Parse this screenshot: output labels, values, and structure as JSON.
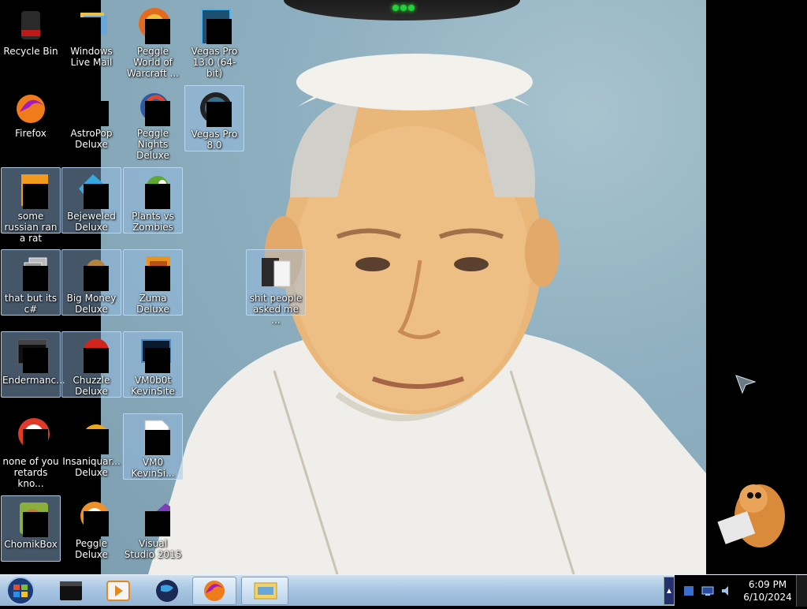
{
  "desktop": {
    "icons": [
      {
        "label": "Recycle Bin",
        "icon": "recycle-bin-icon"
      },
      {
        "label": "Windows Live Mail",
        "icon": "mail-icon"
      },
      {
        "label": "Peggle World of Warcraft ...",
        "icon": "peggle-wow-icon"
      },
      {
        "label": "Vegas Pro 13.0 (64-bit)",
        "icon": "vegas-pro-icon"
      },
      {
        "label": "Firefox",
        "icon": "firefox-icon"
      },
      {
        "label": "AstroPop Deluxe",
        "icon": "astropop-icon"
      },
      {
        "label": "Peggle Nights Deluxe",
        "icon": "peggle-nights-icon"
      },
      {
        "label": "Vegas Pro 8.0",
        "icon": "vegas-pro-8-icon"
      },
      {
        "label": "some russian ran a rat",
        "icon": "file-icon"
      },
      {
        "label": "Bejeweled Deluxe",
        "icon": "bejeweled-icon"
      },
      {
        "label": "Plants vs Zombies",
        "icon": "plants-vs-zombies-icon"
      },
      {
        "label": "that but its c#",
        "icon": "shortcut-icon"
      },
      {
        "label": "Big Money Deluxe",
        "icon": "big-money-icon"
      },
      {
        "label": "Zuma Deluxe",
        "icon": "zuma-icon"
      },
      {
        "label": "shit people asked me ...",
        "icon": "folder-icon"
      },
      {
        "label": "Endermanc...",
        "icon": "window-icon"
      },
      {
        "label": "Chuzzle Deluxe",
        "icon": "chuzzle-icon"
      },
      {
        "label": "VM0b0t KevinSite",
        "icon": "vm-icon"
      },
      {
        "label": "none of you retards kno...",
        "icon": "app-icon"
      },
      {
        "label": "Insaniquar... Deluxe",
        "icon": "insaniquarium-icon"
      },
      {
        "label": "VM0 KevinSi...",
        "icon": "document-icon"
      },
      {
        "label": "ChomikBox",
        "icon": "chomikbox-icon"
      },
      {
        "label": "Peggle Deluxe",
        "icon": "peggle-icon"
      },
      {
        "label": "Visual Studio 2015",
        "icon": "visual-studio-icon"
      }
    ]
  },
  "taskbar": {
    "clock_time": "6:09 PM",
    "clock_date": "6/10/2024",
    "pinned": [
      {
        "icon": "black-box-icon"
      },
      {
        "icon": "media-player-icon"
      },
      {
        "icon": "globe-icon"
      },
      {
        "icon": "firefox-icon"
      },
      {
        "icon": "explorer-icon"
      }
    ]
  },
  "colors": {
    "taskbar_top": "#cfe0f0",
    "taskbar_bottom": "#93b4d6",
    "selection": "#96bee6",
    "wallpaper_sky": "#8fb0c0"
  }
}
